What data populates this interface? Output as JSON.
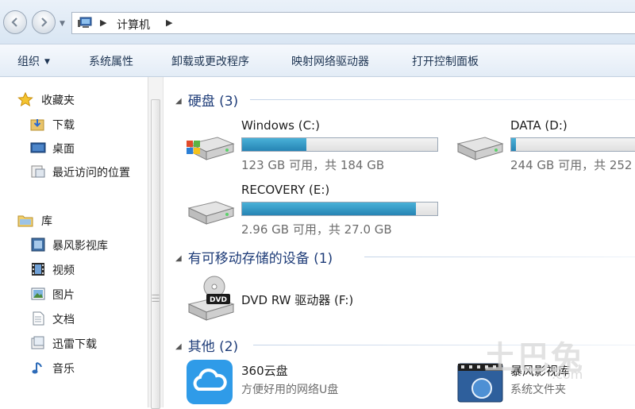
{
  "address": {
    "crumb": "计算机"
  },
  "toolbar": {
    "organize": "组织",
    "system_properties": "系统属性",
    "uninstall": "卸载或更改程序",
    "map_drive": "映射网络驱动器",
    "control_panel": "打开控制面板"
  },
  "nav": {
    "favorites": "收藏夹",
    "downloads": "下载",
    "desktop": "桌面",
    "recent": "最近访问的位置",
    "libraries": "库",
    "storm_library": "暴风影视库",
    "videos": "视频",
    "pictures": "图片",
    "documents": "文档",
    "xunlei": "迅雷下载",
    "music": "音乐"
  },
  "groups": {
    "hdd": "硬盘 (3)",
    "removable": "有可移动存储的设备 (1)",
    "other": "其他 (2)"
  },
  "drives": {
    "c": {
      "name": "Windows (C:)",
      "size": "123 GB 可用，共 184 GB",
      "used_fraction": 0.33
    },
    "d": {
      "name": "DATA (D:)",
      "size": "244 GB 可用，共 252",
      "used_fraction": 0.03
    },
    "e": {
      "name": "RECOVERY (E:)",
      "size": "2.96 GB 可用，共 27.0 GB",
      "used_fraction": 0.89
    },
    "f": {
      "name": "DVD RW 驱动器 (F:)"
    }
  },
  "others": {
    "cloud": {
      "name": "360云盘",
      "sub": "方便好用的网络U盘"
    },
    "storm": {
      "name": "暴风影视库",
      "sub": "系统文件夹"
    }
  },
  "watermark": {
    "main": "土巴兔",
    "sub": ".com"
  }
}
